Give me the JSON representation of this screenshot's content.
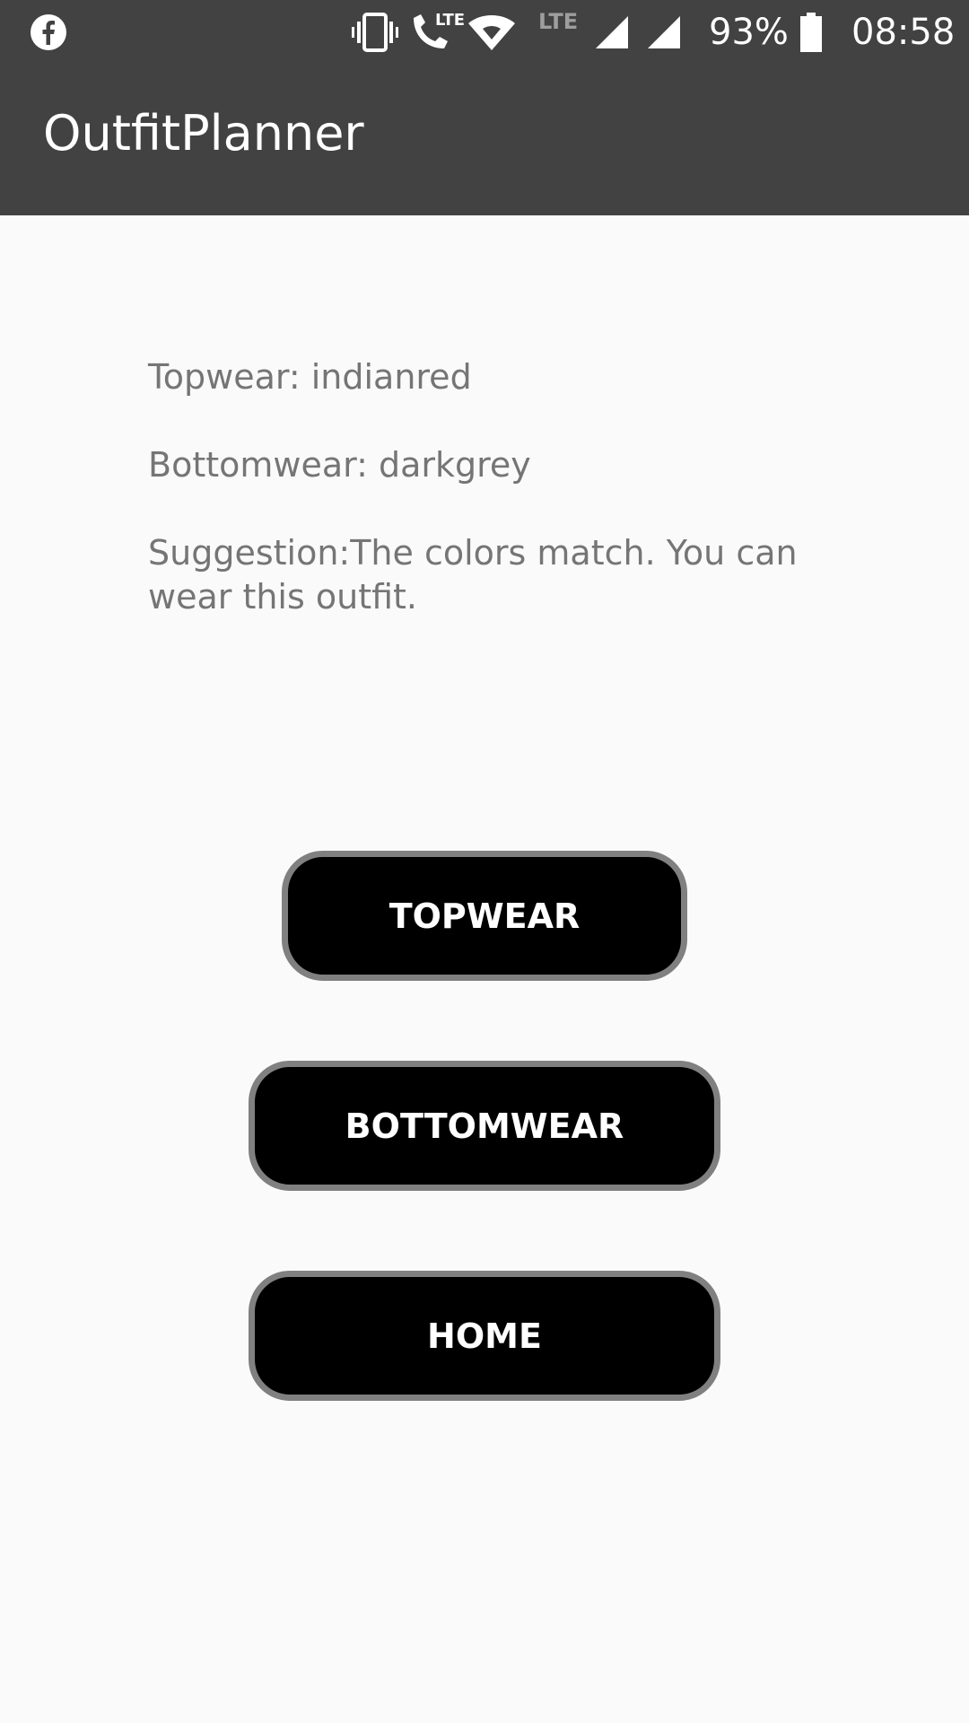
{
  "status_bar": {
    "battery": "93%",
    "time": "08:58",
    "lte_label": "LTE",
    "lte_small": "LTE",
    "icons": [
      "facebook-icon",
      "vibrate-icon",
      "lte-call-icon",
      "wifi-icon",
      "signal-icon",
      "signal-icon",
      "battery-icon"
    ]
  },
  "app": {
    "title": "OutfitPlanner"
  },
  "outfit": {
    "topwear": "Topwear: indianred",
    "bottomwear": "Bottomwear: darkgrey",
    "suggestion": "Suggestion:The colors match. You can wear this outfit."
  },
  "buttons": {
    "topwear": "TOPWEAR",
    "bottomwear": "BOTTOMWEAR",
    "home": "HOME"
  },
  "colors": {
    "app_bar": "#424242",
    "background": "#fafafa",
    "button_fill": "#000000",
    "button_border": "#808080",
    "text_secondary": "#757575"
  }
}
